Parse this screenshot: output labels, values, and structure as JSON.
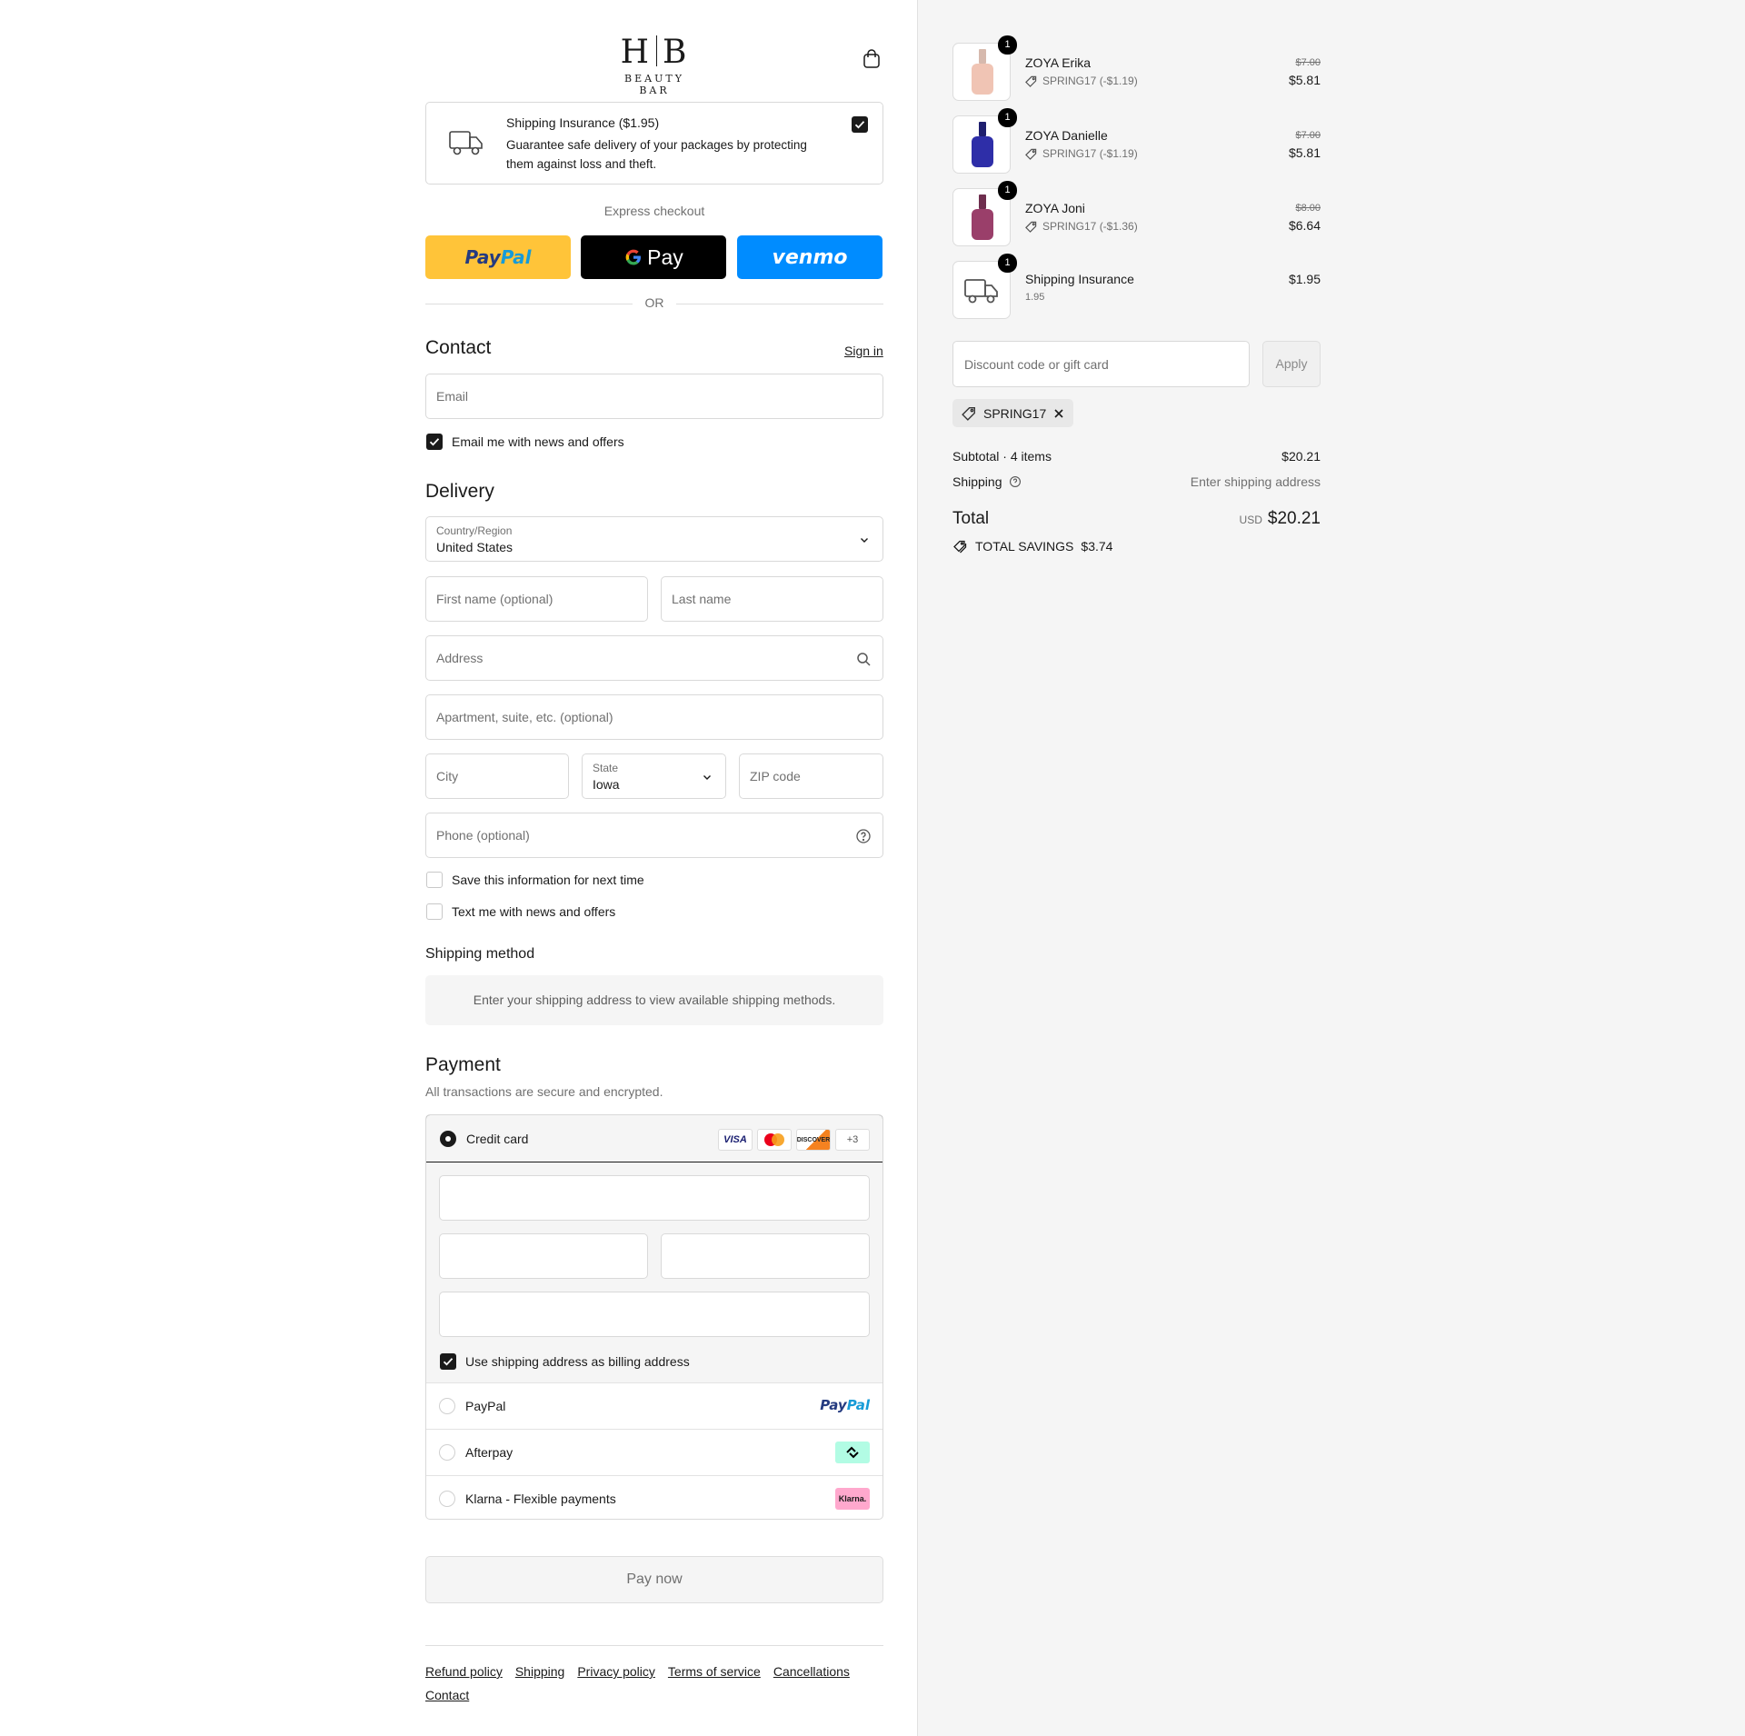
{
  "header": {
    "logo_mark_left": "H",
    "logo_mark_right": "B",
    "logo_sub": "BEAUTY BAR"
  },
  "insurance": {
    "title": "Shipping Insurance ($1.95)",
    "description": "Guarantee safe delivery of your packages by protecting them against loss and theft.",
    "checked": true
  },
  "express": {
    "label": "Express checkout",
    "paypal_a": "Pay",
    "paypal_b": "Pal",
    "gpay": "Pay",
    "venmo": "venmo",
    "or": "OR"
  },
  "contact": {
    "title": "Contact",
    "sign_in": "Sign in",
    "email_placeholder": "Email",
    "news_label": "Email me with news and offers"
  },
  "delivery": {
    "title": "Delivery",
    "country_label": "Country/Region",
    "country_value": "United States",
    "first_name": "First name (optional)",
    "last_name": "Last name",
    "address": "Address",
    "apartment": "Apartment, suite, etc. (optional)",
    "city": "City",
    "state_label": "State",
    "state_value": "Iowa",
    "zip": "ZIP code",
    "phone": "Phone (optional)",
    "save_info": "Save this information for next time",
    "text_news": "Text me with news and offers"
  },
  "shipping_method": {
    "title": "Shipping method",
    "message": "Enter your shipping address to view available shipping methods."
  },
  "payment": {
    "title": "Payment",
    "subtitle": "All transactions are secure and encrypted.",
    "credit_card": "Credit card",
    "card_logos": [
      "VISA",
      "",
      "DISCOVER",
      "+3"
    ],
    "billing_same": "Use shipping address as billing address",
    "paypal": "PayPal",
    "paypal_logo_a": "Pay",
    "paypal_logo_b": "Pal",
    "afterpay": "Afterpay",
    "klarna": "Klarna - Flexible payments",
    "klarna_logo": "Klarna."
  },
  "pay_now": "Pay now",
  "footer": {
    "links": [
      "Refund policy",
      "Shipping",
      "Privacy policy",
      "Terms of service",
      "Cancellations",
      "Contact"
    ]
  },
  "summary": {
    "items": [
      {
        "name": "ZOYA Erika",
        "discount": "SPRING17 (-$1.19)",
        "old_price": "$7.00",
        "price": "$5.81",
        "qty": "1",
        "color": "#f0c4b4"
      },
      {
        "name": "ZOYA Danielle",
        "discount": "SPRING17 (-$1.19)",
        "old_price": "$7.00",
        "price": "$5.81",
        "qty": "1",
        "color": "#2e2ea8"
      },
      {
        "name": "ZOYA Joni",
        "discount": "SPRING17 (-$1.36)",
        "old_price": "$8.00",
        "price": "$6.64",
        "qty": "1",
        "color": "#9a3f6a"
      },
      {
        "name": "Shipping Insurance",
        "discount": "1.95",
        "old_price": "",
        "price": "$1.95",
        "qty": "1",
        "color": ""
      }
    ],
    "discount_placeholder": "Discount code or gift card",
    "apply": "Apply",
    "applied_code": "SPRING17",
    "subtotal_label": "Subtotal · 4 items",
    "subtotal_value": "$20.21",
    "shipping_label": "Shipping",
    "shipping_value": "Enter shipping address",
    "total_label": "Total",
    "currency": "USD",
    "total_value": "$20.21",
    "savings_label": "TOTAL SAVINGS",
    "savings_value": "$3.74"
  }
}
